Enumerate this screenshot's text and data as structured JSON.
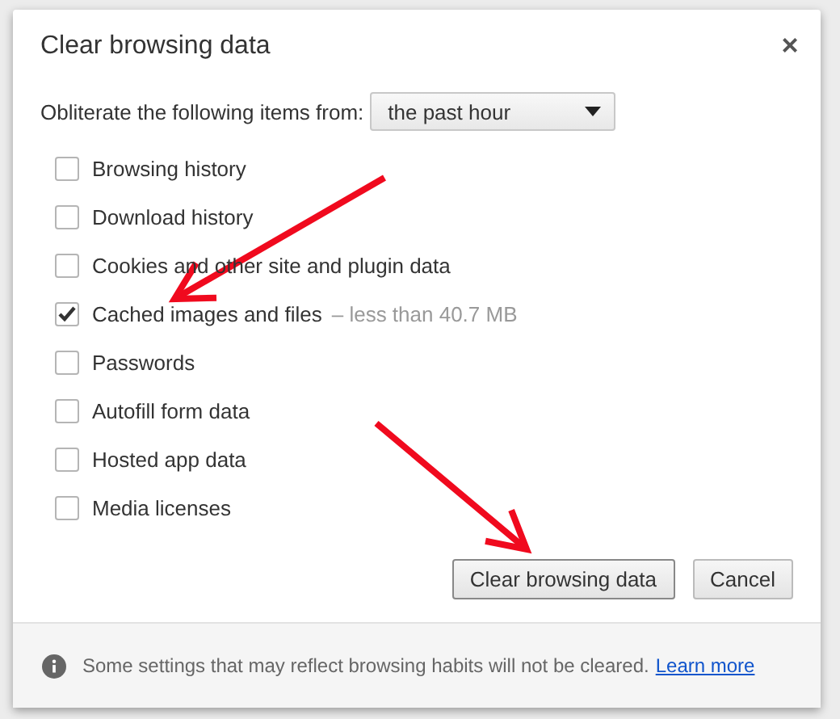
{
  "dialog": {
    "title": "Clear browsing data",
    "close": "×"
  },
  "range": {
    "label": "Obliterate the following items from:",
    "value": "the past hour"
  },
  "items": [
    {
      "label": "Browsing history",
      "checked": false
    },
    {
      "label": "Download history",
      "checked": false
    },
    {
      "label": "Cookies and other site and plugin data",
      "checked": false
    },
    {
      "label": "Cached images and files",
      "detail": "–  less than 40.7 MB",
      "checked": true
    },
    {
      "label": "Passwords",
      "checked": false
    },
    {
      "label": "Autofill form data",
      "checked": false
    },
    {
      "label": "Hosted app data",
      "checked": false
    },
    {
      "label": "Media licenses",
      "checked": false
    }
  ],
  "buttons": [
    {
      "label": "Clear browsing data",
      "kind": "primary"
    },
    {
      "label": "Cancel",
      "kind": "secondary"
    }
  ],
  "footer": {
    "text": "Some settings that may reflect browsing habits will not be cleared.",
    "link": "Learn more"
  },
  "annotations": [
    {
      "kind": "arrow"
    },
    {
      "kind": "arrow"
    }
  ]
}
